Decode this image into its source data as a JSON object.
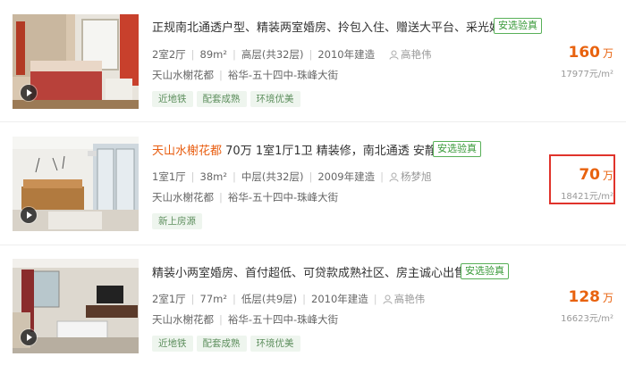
{
  "colors": {
    "accent": "#e8620e",
    "verify_green": "#3a9a3a",
    "highlight_box": "#e0332b"
  },
  "listings": [
    {
      "title": "正规南北通透户型、精装两室婚房、拎包入住、赠送大平台、采光好",
      "title_highlight": "",
      "verify": "安选验真",
      "layout": "2室2厅",
      "area": "89m²",
      "floor": "高层(共32层)",
      "year": "2010年建造",
      "agent": "高艳伟",
      "community": "天山水榭花都",
      "district": "裕华-五十四中-珠峰大街",
      "tags": [
        "近地铁",
        "配套成熟",
        "环境优美"
      ],
      "price": "160",
      "price_unit": "万",
      "unit_price": "17977元/m²"
    },
    {
      "title": " 70万 1室1厅1卫 精装修，南北通透 安静",
      "title_highlight": "天山水榭花都",
      "verify": "安选验真",
      "layout": "1室1厅",
      "area": "38m²",
      "floor": "中层(共32层)",
      "year": "2009年建造",
      "agent": "杨梦旭",
      "community": "天山水榭花都",
      "district": "裕华-五十四中-珠峰大街",
      "tags": [
        "新上房源"
      ],
      "price": "70",
      "price_unit": "万",
      "unit_price": "18421元/m²"
    },
    {
      "title": "精装小两室婚房、首付超低、可贷款成熟社区、房主诚心出售",
      "title_highlight": "",
      "verify": "安选验真",
      "layout": "2室1厅",
      "area": "77m²",
      "floor": "低层(共9层)",
      "year": "2010年建造",
      "agent": "高艳伟",
      "community": "天山水榭花都",
      "district": "裕华-五十四中-珠峰大街",
      "tags": [
        "近地铁",
        "配套成熟",
        "环境优美"
      ],
      "price": "128",
      "price_unit": "万",
      "unit_price": "16623元/m²"
    }
  ]
}
